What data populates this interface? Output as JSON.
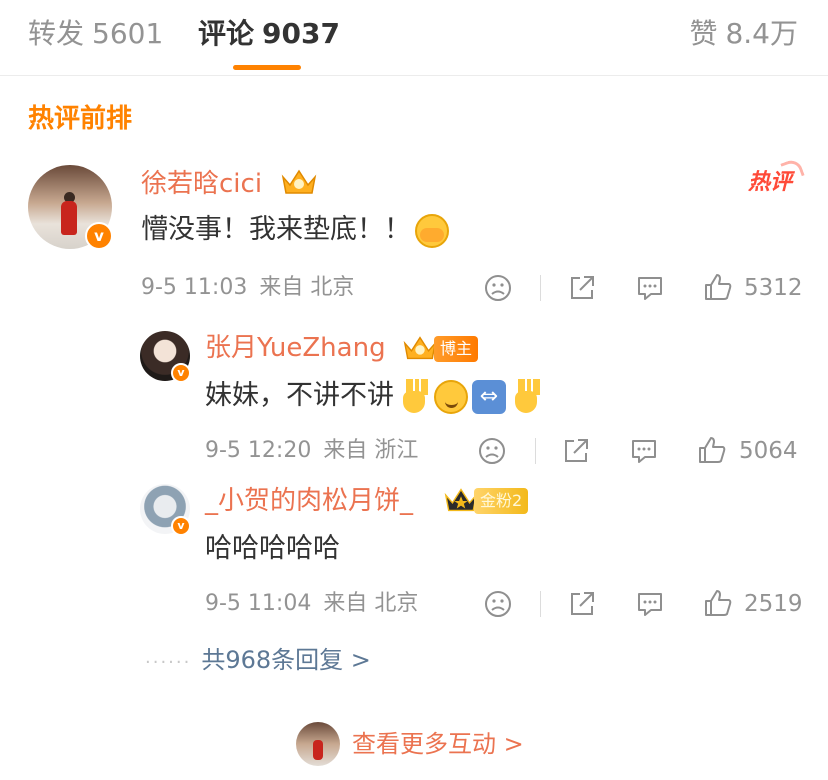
{
  "tabs": {
    "repost_label": "转发",
    "repost_count": "5601",
    "comment_label": "评论",
    "comment_count": "9037",
    "like_label": "赞",
    "like_count": "8.4万"
  },
  "section_title": "热评前排",
  "colors": {
    "accent": "#ff8200",
    "username": "#eb7350",
    "link": "#5d7895",
    "hot": "#ff4a38"
  },
  "comment": {
    "username": "徐若晗cici",
    "hot_badge": "热评",
    "text": "懵没事！我来垫底！！",
    "emoji": "covering-face-emoji",
    "time": "9-5 11:03",
    "source": "来自 北京",
    "likes": "5312",
    "replies": [
      {
        "username": "张月YueZhang",
        "badge": "博主",
        "text": "妹妹，不讲不讲",
        "emojis": [
          "raised-hand-emoji",
          "smile-emoji",
          "left-right-arrow-emoji",
          "raised-hand-emoji"
        ],
        "time": "9-5 12:20",
        "source": "来自 浙江",
        "likes": "5064"
      },
      {
        "username": "_小贺的肉松月饼_",
        "badge": "金粉2",
        "text": "哈哈哈哈哈",
        "time": "9-5 11:04",
        "source": "来自 北京",
        "likes": "2519"
      }
    ],
    "more_replies": "共968条回复 >"
  },
  "more_interact": "查看更多互动 >"
}
